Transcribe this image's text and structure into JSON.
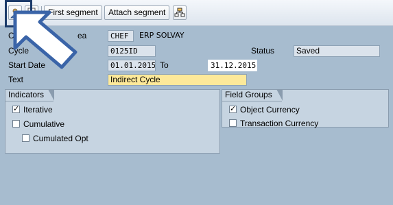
{
  "toolbar": {
    "icon1": "person-icon",
    "icon2": "document-icon",
    "first_segment": "First segment",
    "attach_segment": "Attach segment",
    "icon3": "hierarchy-icon"
  },
  "form": {
    "controlling_area": {
      "label_visible": "Con",
      "label_tail": "ea",
      "value": "CHEF",
      "text": "ERP SOLVAY"
    },
    "cycle": {
      "label": "Cycle",
      "value": "0125ID",
      "status_label": "Status",
      "status_value": "Saved"
    },
    "start_date": {
      "label": "Start Date",
      "value": "01.01.2015",
      "to_label": "To",
      "to_value": "31.12.2015"
    },
    "text": {
      "label": "Text",
      "value": "Indirect Cycle"
    }
  },
  "indicators": {
    "title": "Indicators",
    "items": [
      {
        "label": "Iterative",
        "checked": true
      },
      {
        "label": "Cumulative",
        "checked": false
      },
      {
        "label": "Cumulated Opt",
        "checked": false
      }
    ]
  },
  "field_groups": {
    "title": "Field Groups",
    "items": [
      {
        "label": "Object Currency",
        "checked": true
      },
      {
        "label": "Transaction Currency",
        "checked": false
      }
    ]
  },
  "colors": {
    "background": "#a7bccf",
    "group": "#c6d4e1",
    "highlight": "#1c3b6a",
    "arrow": "#3a64a8"
  }
}
